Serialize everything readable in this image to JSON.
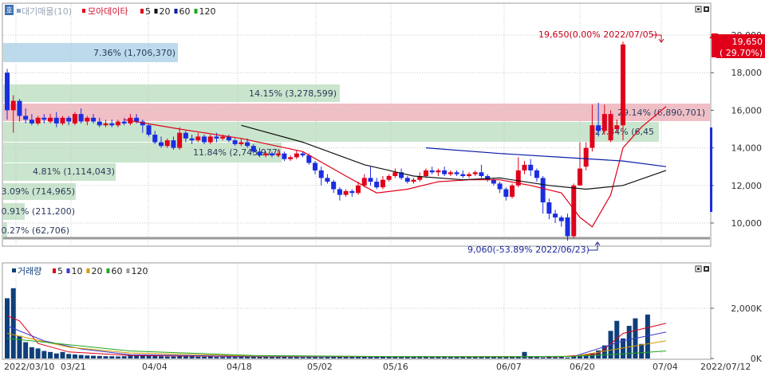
{
  "price_panel": {
    "legend_prefix": "대기매물(10)",
    "legend_prefix_icon": "volume-profile-icon",
    "legend_series": "모아데이타",
    "ma_legend": [
      {
        "label": "5",
        "color": "#e0001a"
      },
      {
        "label": "20",
        "color": "#111111"
      },
      {
        "label": "60",
        "color": "#0a1ea8"
      },
      {
        "label": "120",
        "color": "#1fa81f"
      }
    ],
    "corner_badge": "호",
    "high_annotation": "19,650(0.00% 2022/07/05)",
    "low_annotation": "9,060(-53.89% 2022/06/23)",
    "current_price": "19,650",
    "current_change": "( 29.70%)",
    "volume_profile": [
      {
        "label": "7.36% (1,706,370)",
        "color": "#b8d8ea"
      },
      {
        "label": "14.15% (3,278,599)",
        "color": "#c6e4ca"
      },
      {
        "label": "29.14% (6,890,701)",
        "color": "#efbcc3"
      },
      {
        "label": "27.84% (6,45",
        "color": "#c6e4ca"
      },
      {
        "label": "11.84% (2,743,977)",
        "color": "#c6e4ca"
      },
      {
        "label": "4.81% (1,114,043)",
        "color": "#c6e4ca"
      },
      {
        "label": "3.09% (714,965)",
        "color": "#c6e4ca"
      },
      {
        "label": "0.91% (211,200)",
        "color": "#c6e4ca"
      },
      {
        "label": "0.27% (62,706)",
        "color": "#c6e4ca"
      }
    ]
  },
  "volume_panel": {
    "legend": "거래량",
    "ma_legend": [
      {
        "label": "5",
        "color": "#e0001a"
      },
      {
        "label": "10",
        "color": "#3a3ad0"
      },
      {
        "label": "20",
        "color": "#d89a00"
      },
      {
        "label": "60",
        "color": "#1fa81f"
      },
      {
        "label": "120",
        "color": "#9a9a9a"
      }
    ]
  },
  "colors": {
    "up": "#e0001a",
    "down": "#1a2ee0",
    "volume": "#0f3f7a"
  },
  "chart_data": {
    "type": "candlestick",
    "price_yaxis": {
      "ticks": [
        10000,
        12000,
        14000,
        16000,
        18000,
        20000
      ],
      "tick_labels": [
        "10,000",
        "12,000",
        "14,000",
        "16,000",
        "18,000",
        "20,000"
      ]
    },
    "volume_yaxis": {
      "ticks": [
        0,
        2000
      ],
      "tick_labels": [
        "0K",
        "2,000K"
      ]
    },
    "x_labels": [
      "2022/03/10",
      "03/21",
      "04/04",
      "04/18",
      "05/02",
      "05/16",
      "06/07",
      "06/20",
      "07/04",
      "2022/07/12"
    ],
    "candles": [
      {
        "o": 18000,
        "h": 18200,
        "c": 16000,
        "l": 15500
      },
      {
        "o": 16000,
        "h": 16800,
        "c": 16500,
        "l": 14800
      },
      {
        "o": 16500,
        "h": 16600,
        "c": 15700,
        "l": 15400
      },
      {
        "o": 15700,
        "h": 16100,
        "c": 15500,
        "l": 15300
      },
      {
        "o": 15500,
        "h": 15800,
        "c": 15300,
        "l": 15200
      },
      {
        "o": 15300,
        "h": 15700,
        "c": 15600,
        "l": 15200
      },
      {
        "o": 15600,
        "h": 15800,
        "c": 15500,
        "l": 15300
      },
      {
        "o": 15400,
        "h": 15800,
        "c": 15600,
        "l": 15300
      },
      {
        "o": 15600,
        "h": 15900,
        "c": 15300,
        "l": 15100
      },
      {
        "o": 15300,
        "h": 15700,
        "c": 15600,
        "l": 15200
      },
      {
        "o": 15600,
        "h": 15700,
        "c": 15400,
        "l": 15200
      },
      {
        "o": 15300,
        "h": 15900,
        "c": 15800,
        "l": 15200
      },
      {
        "o": 15800,
        "h": 16100,
        "c": 15400,
        "l": 15300
      },
      {
        "o": 15400,
        "h": 15700,
        "c": 15600,
        "l": 15200
      },
      {
        "o": 15600,
        "h": 15800,
        "c": 15400,
        "l": 15300
      },
      {
        "o": 15400,
        "h": 15600,
        "c": 15200,
        "l": 15100
      },
      {
        "o": 15200,
        "h": 15500,
        "c": 15300,
        "l": 15100
      },
      {
        "o": 15300,
        "h": 15500,
        "c": 15200,
        "l": 15100
      },
      {
        "o": 15200,
        "h": 15500,
        "c": 15400,
        "l": 15100
      },
      {
        "o": 15400,
        "h": 15600,
        "c": 15300,
        "l": 15200
      },
      {
        "o": 15300,
        "h": 15800,
        "c": 15600,
        "l": 15200
      },
      {
        "o": 15600,
        "h": 15800,
        "c": 15400,
        "l": 15300
      },
      {
        "o": 15400,
        "h": 15500,
        "c": 15200,
        "l": 14800
      },
      {
        "o": 15200,
        "h": 15300,
        "c": 14700,
        "l": 14600
      },
      {
        "o": 14700,
        "h": 14900,
        "c": 14300,
        "l": 14200
      },
      {
        "o": 14300,
        "h": 14600,
        "c": 14100,
        "l": 14000
      },
      {
        "o": 14100,
        "h": 14500,
        "c": 14400,
        "l": 14000
      },
      {
        "o": 14400,
        "h": 14600,
        "c": 14000,
        "l": 13900
      },
      {
        "o": 14000,
        "h": 15100,
        "c": 14800,
        "l": 13900
      },
      {
        "o": 14800,
        "h": 14900,
        "c": 14500,
        "l": 14300
      },
      {
        "o": 14500,
        "h": 14700,
        "c": 14400,
        "l": 14200
      },
      {
        "o": 14400,
        "h": 14800,
        "c": 14600,
        "l": 14300
      },
      {
        "o": 14600,
        "h": 14700,
        "c": 14300,
        "l": 14200
      },
      {
        "o": 14300,
        "h": 14700,
        "c": 14600,
        "l": 14200
      },
      {
        "o": 14600,
        "h": 14800,
        "c": 14500,
        "l": 14300
      },
      {
        "o": 14500,
        "h": 14700,
        "c": 14600,
        "l": 14400
      },
      {
        "o": 14600,
        "h": 14700,
        "c": 14400,
        "l": 14300
      },
      {
        "o": 14400,
        "h": 14500,
        "c": 14200,
        "l": 14100
      },
      {
        "o": 14200,
        "h": 14500,
        "c": 14300,
        "l": 14100
      },
      {
        "o": 14300,
        "h": 14500,
        "c": 14100,
        "l": 14000
      },
      {
        "o": 14100,
        "h": 14200,
        "c": 13800,
        "l": 13700
      },
      {
        "o": 13800,
        "h": 14000,
        "c": 13600,
        "l": 13500
      },
      {
        "o": 13600,
        "h": 13800,
        "c": 13700,
        "l": 13500
      },
      {
        "o": 13700,
        "h": 13800,
        "c": 13600,
        "l": 13500
      },
      {
        "o": 13600,
        "h": 13900,
        "c": 13700,
        "l": 13500
      },
      {
        "o": 13700,
        "h": 13800,
        "c": 13400,
        "l": 13300
      },
      {
        "o": 13400,
        "h": 13600,
        "c": 13500,
        "l": 13300
      },
      {
        "o": 13500,
        "h": 13900,
        "c": 13700,
        "l": 13400
      },
      {
        "o": 13700,
        "h": 13800,
        "c": 13600,
        "l": 13500
      },
      {
        "o": 13600,
        "h": 13700,
        "c": 13200,
        "l": 13100
      },
      {
        "o": 13200,
        "h": 13300,
        "c": 12800,
        "l": 12600
      },
      {
        "o": 12800,
        "h": 13000,
        "c": 12400,
        "l": 12000
      },
      {
        "o": 12400,
        "h": 12600,
        "c": 12200,
        "l": 12100
      },
      {
        "o": 12200,
        "h": 12300,
        "c": 11800,
        "l": 11600
      },
      {
        "o": 11800,
        "h": 11900,
        "c": 11500,
        "l": 11200
      },
      {
        "o": 11500,
        "h": 11800,
        "c": 11700,
        "l": 11400
      },
      {
        "o": 11700,
        "h": 11800,
        "c": 11600,
        "l": 11400
      },
      {
        "o": 11600,
        "h": 12200,
        "c": 12000,
        "l": 11500
      },
      {
        "o": 12000,
        "h": 12600,
        "c": 12400,
        "l": 11900
      },
      {
        "o": 12400,
        "h": 13000,
        "c": 12200,
        "l": 12000
      },
      {
        "o": 12200,
        "h": 12400,
        "c": 11900,
        "l": 11800
      },
      {
        "o": 11900,
        "h": 12500,
        "c": 12300,
        "l": 11800
      },
      {
        "o": 12300,
        "h": 12600,
        "c": 12500,
        "l": 12200
      },
      {
        "o": 12500,
        "h": 12900,
        "c": 12700,
        "l": 12400
      },
      {
        "o": 12700,
        "h": 12900,
        "c": 12400,
        "l": 12300
      },
      {
        "o": 12400,
        "h": 12500,
        "c": 12200,
        "l": 12100
      },
      {
        "o": 12200,
        "h": 12400,
        "c": 12300,
        "l": 12100
      },
      {
        "o": 12300,
        "h": 12700,
        "c": 12500,
        "l": 12200
      },
      {
        "o": 12500,
        "h": 12900,
        "c": 12800,
        "l": 12400
      },
      {
        "o": 12800,
        "h": 13000,
        "c": 12700,
        "l": 12600
      },
      {
        "o": 12700,
        "h": 12900,
        "c": 12800,
        "l": 12500
      },
      {
        "o": 12800,
        "h": 13000,
        "c": 12600,
        "l": 12500
      },
      {
        "o": 12600,
        "h": 12800,
        "c": 12700,
        "l": 12500
      },
      {
        "o": 12700,
        "h": 12800,
        "c": 12600,
        "l": 12500
      },
      {
        "o": 12600,
        "h": 12800,
        "c": 12500,
        "l": 12400
      },
      {
        "o": 12500,
        "h": 12700,
        "c": 12600,
        "l": 12400
      },
      {
        "o": 12600,
        "h": 12800,
        "c": 12700,
        "l": 12500
      },
      {
        "o": 12700,
        "h": 13100,
        "c": 12500,
        "l": 12400
      },
      {
        "o": 12500,
        "h": 12600,
        "c": 12300,
        "l": 12200
      },
      {
        "o": 12300,
        "h": 12400,
        "c": 12100,
        "l": 12000
      },
      {
        "o": 12100,
        "h": 12200,
        "c": 11800,
        "l": 11600
      },
      {
        "o": 11800,
        "h": 11900,
        "c": 11400,
        "l": 11200
      },
      {
        "o": 11400,
        "h": 12100,
        "c": 12000,
        "l": 11300
      },
      {
        "o": 12000,
        "h": 13500,
        "c": 12800,
        "l": 11900
      },
      {
        "o": 12800,
        "h": 13300,
        "c": 13100,
        "l": 12600
      },
      {
        "o": 13100,
        "h": 13400,
        "c": 12800,
        "l": 12500
      },
      {
        "o": 12800,
        "h": 12900,
        "c": 12400,
        "l": 12200
      },
      {
        "o": 12400,
        "h": 12500,
        "c": 11100,
        "l": 10500
      },
      {
        "o": 11100,
        "h": 11300,
        "c": 10500,
        "l": 10200
      },
      {
        "o": 10500,
        "h": 10700,
        "c": 10300,
        "l": 10000
      },
      {
        "o": 10300,
        "h": 10400,
        "c": 10100,
        "l": 9800
      },
      {
        "o": 10300,
        "h": 10500,
        "c": 9300,
        "l": 9060
      },
      {
        "o": 9300,
        "h": 12100,
        "c": 12000,
        "l": 9200
      },
      {
        "o": 12000,
        "h": 14300,
        "c": 12900,
        "l": 12900
      },
      {
        "o": 13000,
        "h": 14300,
        "c": 14000,
        "l": 12800
      },
      {
        "o": 14000,
        "h": 16300,
        "c": 15200,
        "l": 13800
      },
      {
        "o": 15200,
        "h": 16400,
        "c": 14900,
        "l": 14600
      },
      {
        "o": 14900,
        "h": 16300,
        "c": 15800,
        "l": 14700
      },
      {
        "o": 14400,
        "h": 16000,
        "c": 15800,
        "l": 14300
      },
      {
        "o": 15000,
        "h": 15500,
        "c": 15200,
        "l": 14800
      },
      {
        "o": 15200,
        "h": 19650,
        "c": 19500,
        "l": 14400
      }
    ],
    "ma5": [
      [
        19,
        15500
      ],
      [
        28,
        15000
      ],
      [
        38,
        14500
      ],
      [
        48,
        13800
      ],
      [
        55,
        12500
      ],
      [
        60,
        11600
      ],
      [
        65,
        11800
      ],
      [
        70,
        12200
      ],
      [
        75,
        12300
      ],
      [
        80,
        12300
      ],
      [
        85,
        12000
      ],
      [
        90,
        11600
      ],
      [
        93,
        10300
      ],
      [
        95,
        9800
      ],
      [
        98,
        11500
      ],
      [
        100,
        14000
      ],
      [
        103,
        15100
      ],
      [
        107,
        16200
      ]
    ],
    "ma20": [
      [
        38,
        15200
      ],
      [
        48,
        14300
      ],
      [
        58,
        13100
      ],
      [
        66,
        12500
      ],
      [
        74,
        12300
      ],
      [
        80,
        12400
      ],
      [
        88,
        12000
      ],
      [
        94,
        11800
      ],
      [
        100,
        12000
      ],
      [
        107,
        12800
      ]
    ],
    "ma60": [
      [
        68,
        14000
      ],
      [
        80,
        13700
      ],
      [
        90,
        13500
      ],
      [
        100,
        13300
      ],
      [
        107,
        13000
      ]
    ],
    "volume": [
      2400,
      2800,
      900,
      650,
      450,
      400,
      300,
      260,
      200,
      260,
      180,
      160,
      140,
      120,
      110,
      100,
      90,
      90,
      80,
      90,
      130,
      110,
      120,
      140,
      100,
      90,
      80,
      80,
      120,
      90,
      80,
      70,
      70,
      80,
      60,
      60,
      60,
      60,
      70,
      60,
      70,
      60,
      60,
      60,
      60,
      70,
      60,
      60,
      50,
      60,
      60,
      50,
      60,
      80,
      70,
      60,
      60,
      60,
      70,
      60,
      60,
      60,
      60,
      60,
      60,
      60,
      60,
      60,
      60,
      60,
      60,
      50,
      50,
      60,
      60,
      60,
      60,
      60,
      60,
      60,
      60,
      60,
      60,
      60,
      260,
      70,
      60,
      40,
      70,
      50,
      90,
      40,
      80,
      90,
      160,
      220,
      320,
      520,
      1100,
      1500,
      800,
      1300,
      1600,
      580,
      1750
    ],
    "vol_ma5": [
      [
        0,
        1700
      ],
      [
        2,
        1500
      ],
      [
        5,
        600
      ],
      [
        10,
        260
      ],
      [
        20,
        120
      ],
      [
        40,
        70
      ],
      [
        60,
        70
      ],
      [
        90,
        70
      ],
      [
        96,
        180
      ],
      [
        100,
        1000
      ],
      [
        107,
        1400
      ]
    ],
    "vol_ma10": [
      [
        0,
        1300
      ],
      [
        6,
        700
      ],
      [
        12,
        380
      ],
      [
        20,
        150
      ],
      [
        40,
        80
      ],
      [
        70,
        70
      ],
      [
        92,
        80
      ],
      [
        100,
        700
      ],
      [
        107,
        1050
      ]
    ],
    "vol_ma20": [
      [
        0,
        1000
      ],
      [
        10,
        450
      ],
      [
        20,
        220
      ],
      [
        40,
        100
      ],
      [
        70,
        70
      ],
      [
        92,
        80
      ],
      [
        100,
        420
      ],
      [
        107,
        700
      ]
    ],
    "vol_ma60": [
      [
        0,
        800
      ],
      [
        20,
        300
      ],
      [
        40,
        120
      ],
      [
        60,
        80
      ],
      [
        80,
        70
      ],
      [
        92,
        90
      ],
      [
        100,
        180
      ],
      [
        107,
        300
      ]
    ]
  }
}
